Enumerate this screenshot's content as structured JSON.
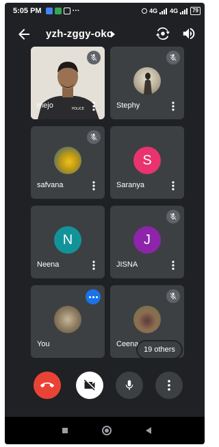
{
  "status_bar": {
    "time": "5:05 PM",
    "dots": "···",
    "network_1": "4G",
    "network_2": "4G",
    "battery": "79"
  },
  "header": {
    "meeting_code": "yzh-zggy-okc"
  },
  "tiles": [
    {
      "name": "mejo",
      "muted": true
    },
    {
      "name": "Stephy",
      "muted": true
    },
    {
      "name": "safvana",
      "muted": true
    },
    {
      "name": "Saranya",
      "muted": false,
      "initial": "S",
      "color": "#e8336f"
    },
    {
      "name": "Neena",
      "muted": false,
      "initial": "N",
      "color": "#12939a"
    },
    {
      "name": "JISNA",
      "muted": true,
      "initial": "J",
      "color": "#8e24aa"
    },
    {
      "name": "You",
      "muted": false,
      "speaking": true
    },
    {
      "name": "Ceena",
      "muted": true
    }
  ],
  "others_chip": "19 others",
  "colors": {
    "background": "#202124",
    "tile": "#3c4043",
    "end_call": "#ea4335",
    "speaking": "#1a73e8"
  },
  "icons": [
    "back-arrow-icon",
    "switch-camera-icon",
    "speaker-icon",
    "mic-off-icon",
    "more-vert-icon",
    "end-call-icon",
    "video-off-icon",
    "mic-icon"
  ]
}
